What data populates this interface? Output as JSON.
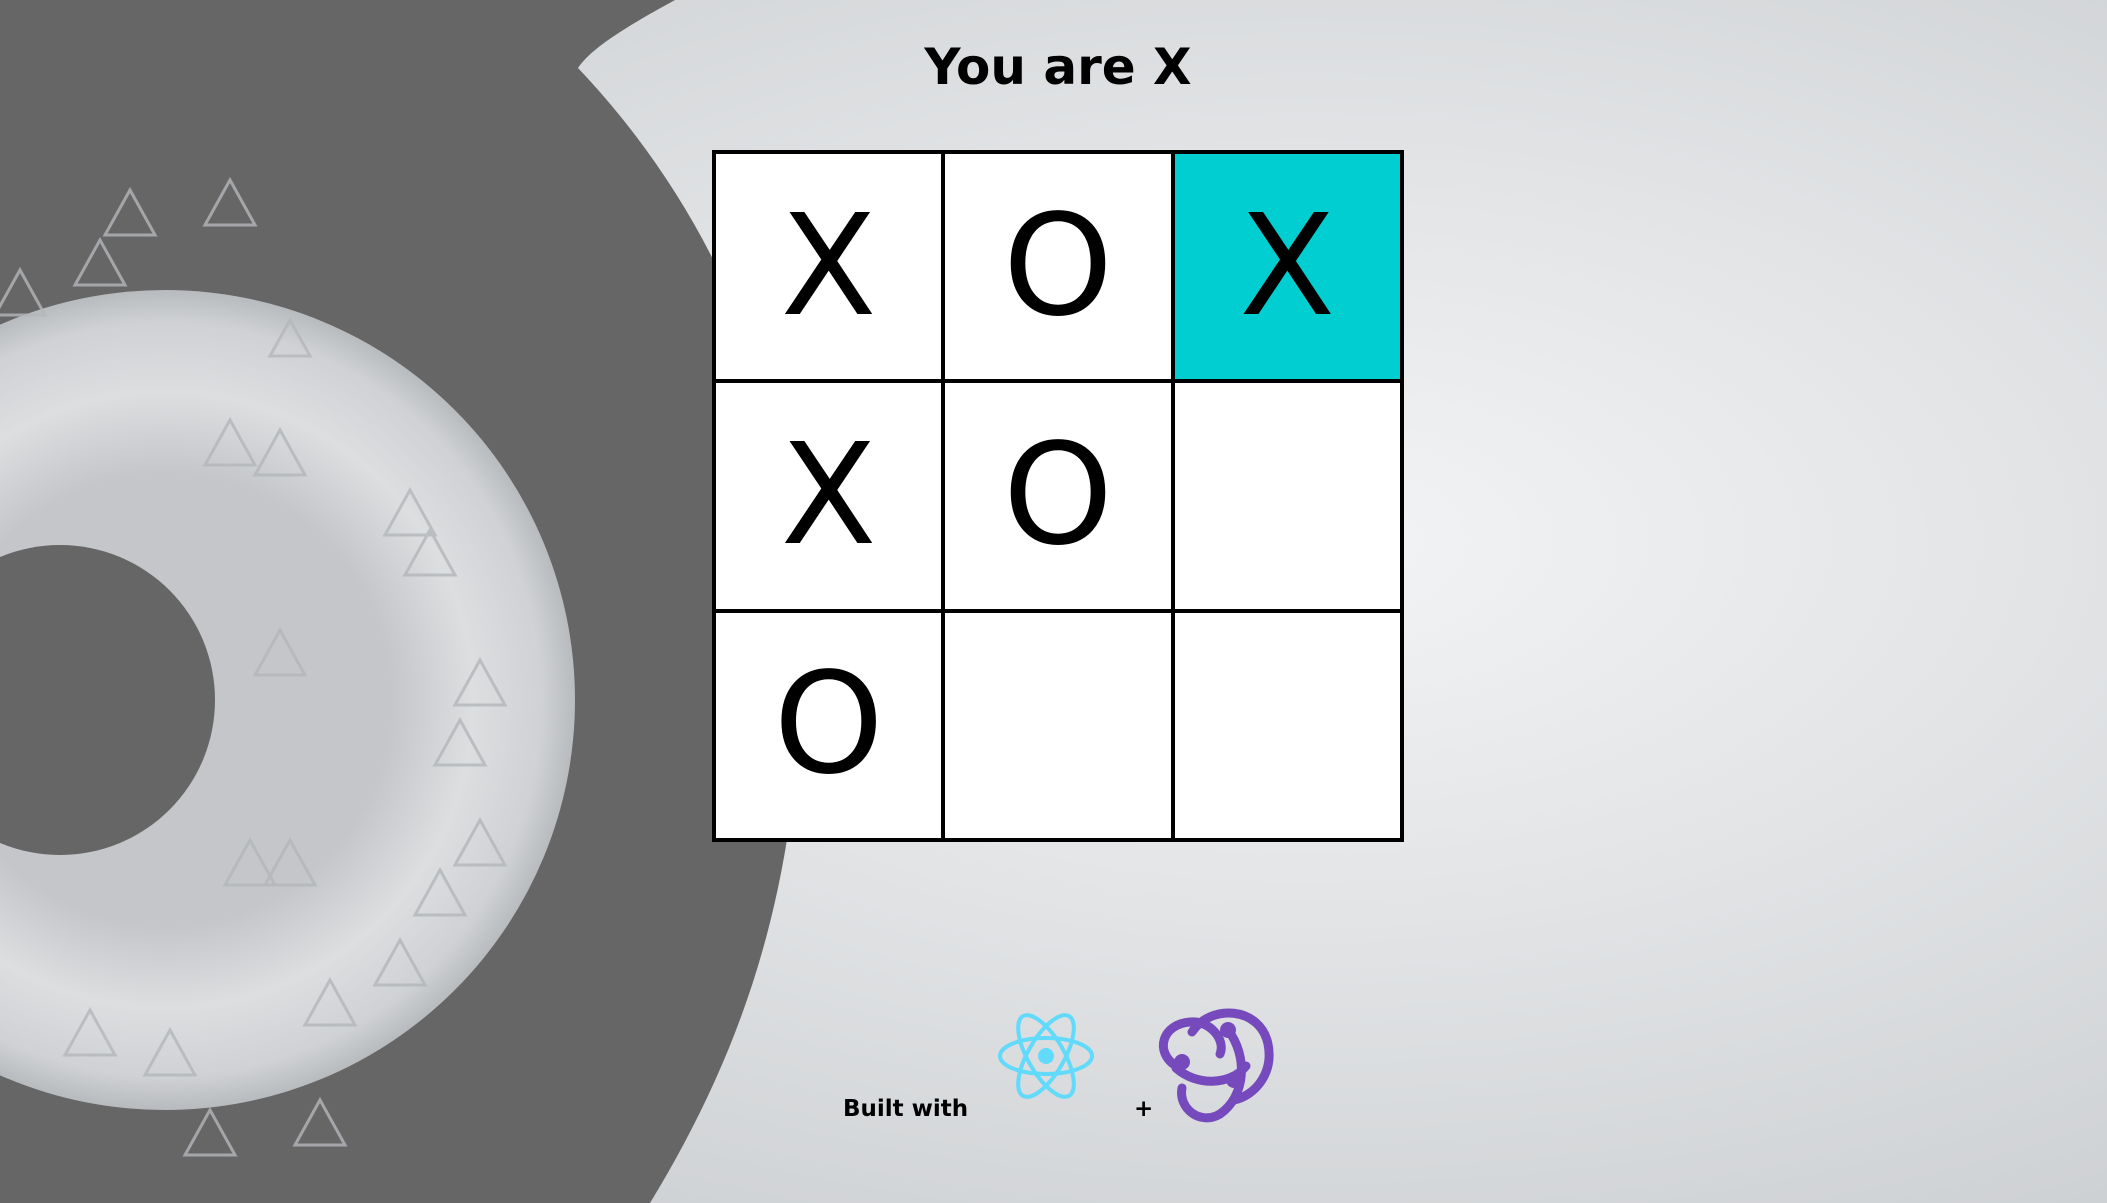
{
  "header": {
    "title": "You are X"
  },
  "board": {
    "cells": [
      {
        "value": "X",
        "highlighted": false
      },
      {
        "value": "O",
        "highlighted": false
      },
      {
        "value": "X",
        "highlighted": true
      },
      {
        "value": "X",
        "highlighted": false
      },
      {
        "value": "O",
        "highlighted": false
      },
      {
        "value": "",
        "highlighted": false
      },
      {
        "value": "O",
        "highlighted": false
      },
      {
        "value": "",
        "highlighted": false
      },
      {
        "value": "",
        "highlighted": false
      }
    ],
    "highlight_color": "#00CED1"
  },
  "footer": {
    "built_with_label": "Built with",
    "plus_label": "+",
    "logos": [
      "react-logo",
      "redux-logo"
    ],
    "react_color": "#61DAFB",
    "redux_color": "#764ABC"
  }
}
